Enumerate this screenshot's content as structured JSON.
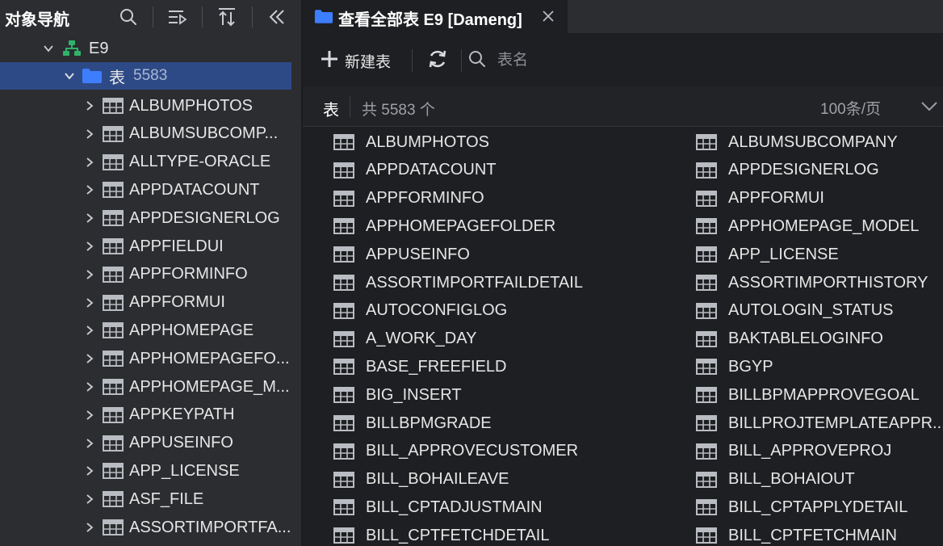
{
  "navigator": {
    "title": "对象导航",
    "connection": "E9",
    "table_folder": {
      "label": "表",
      "count": "5583"
    },
    "tables": [
      "ALBUMPHOTOS",
      "ALBUMSUBCOMP...",
      "ALLTYPE-ORACLE",
      "APPDATACOUNT",
      "APPDESIGNERLOG",
      "APPFIELDUI",
      "APPFORMINFO",
      "APPFORMUI",
      "APPHOMEPAGE",
      "APPHOMEPAGEFO...",
      "APPHOMEPAGE_M...",
      "APPKEYPATH",
      "APPUSEINFO",
      "APP_LICENSE",
      "ASF_FILE",
      "ASSORTIMPORTFA..."
    ]
  },
  "tab": {
    "title": "查看全部表 E9 [Dameng]"
  },
  "toolbar": {
    "new_table_label": "新建表",
    "search_placeholder": "表名"
  },
  "list_header": {
    "label": "表",
    "count_text": "共 5583 个",
    "page_size": "100条/页"
  },
  "table_grid": [
    [
      "ALBUMPHOTOS",
      "ALBUMSUBCOMPANY"
    ],
    [
      "APPDATACOUNT",
      "APPDESIGNERLOG"
    ],
    [
      "APPFORMINFO",
      "APPFORMUI"
    ],
    [
      "APPHOMEPAGEFOLDER",
      "APPHOMEPAGE_MODEL"
    ],
    [
      "APPUSEINFO",
      "APP_LICENSE"
    ],
    [
      "ASSORTIMPORTFAILDETAIL",
      "ASSORTIMPORTHISTORY"
    ],
    [
      "AUTOCONFIGLOG",
      "AUTOLOGIN_STATUS"
    ],
    [
      "A_WORK_DAY",
      "BAKTABLELOGINFO"
    ],
    [
      "BASE_FREEFIELD",
      "BGYP"
    ],
    [
      "BIG_INSERT",
      "BILLBPMAPPROVEGOAL"
    ],
    [
      "BILLBPMGRADE",
      "BILLPROJTEMPLATEAPPR..."
    ],
    [
      "BILL_APPROVECUSTOMER",
      "BILL_APPROVEPROJ"
    ],
    [
      "BILL_BOHAILEAVE",
      "BILL_BOHAIOUT"
    ],
    [
      "BILL_CPTADJUSTMAIN",
      "BILL_CPTAPPLYDETAIL"
    ],
    [
      "BILL_CPTFETCHDETAIL",
      "BILL_CPTFETCHMAIN"
    ]
  ],
  "colors": {
    "accent": "#2e4a86",
    "folder": "#3d7eff",
    "connection_icon": "#2fb36b"
  }
}
